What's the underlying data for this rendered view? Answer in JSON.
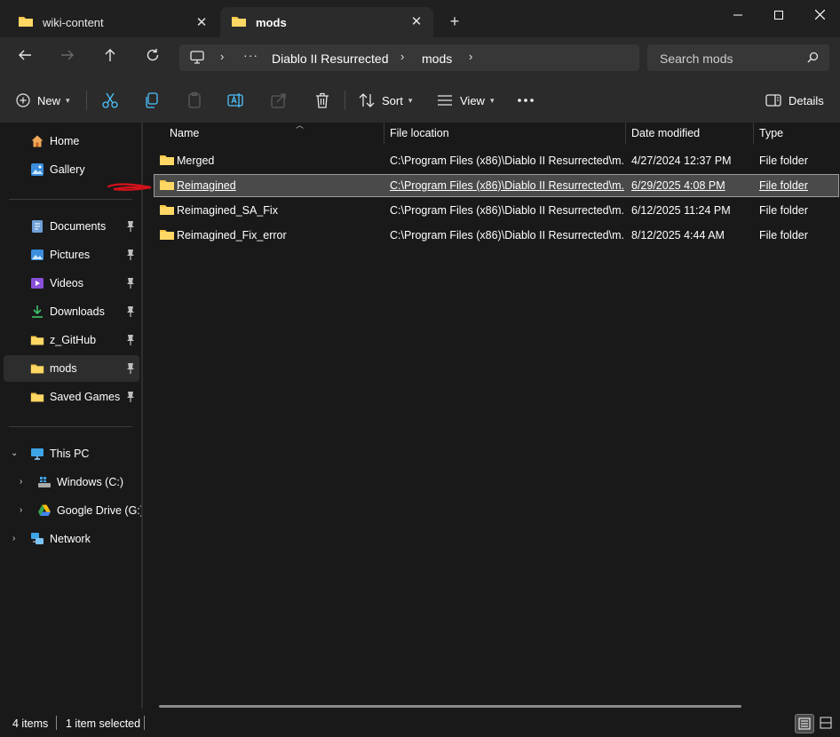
{
  "tabs": [
    {
      "label": "wiki-content",
      "active": false
    },
    {
      "label": "mods",
      "active": true
    }
  ],
  "address": {
    "crumbs": [
      "Diablo II Resurrected",
      "mods"
    ]
  },
  "search": {
    "placeholder": "Search mods"
  },
  "commandbar": {
    "new_label": "New",
    "sort_label": "Sort",
    "view_label": "View",
    "details_label": "Details"
  },
  "sidebar": {
    "top": [
      {
        "label": "Home",
        "icon": "home-icon"
      },
      {
        "label": "Gallery",
        "icon": "gallery-icon"
      }
    ],
    "pinned": [
      {
        "label": "Documents",
        "icon": "documents-icon"
      },
      {
        "label": "Pictures",
        "icon": "pictures-icon"
      },
      {
        "label": "Videos",
        "icon": "videos-icon"
      },
      {
        "label": "Downloads",
        "icon": "downloads-icon"
      },
      {
        "label": "z_GitHub",
        "icon": "folder-icon"
      },
      {
        "label": "mods",
        "icon": "folder-icon",
        "selected": true
      },
      {
        "label": "Saved Games",
        "icon": "folder-icon"
      }
    ],
    "tree": [
      {
        "label": "This PC",
        "icon": "this-pc-icon",
        "expanded": true
      },
      {
        "label": "Windows (C:)",
        "icon": "drive-icon"
      },
      {
        "label": "Google Drive (G:)",
        "icon": "google-drive-icon"
      },
      {
        "label": "Network",
        "icon": "network-icon"
      }
    ]
  },
  "columns": [
    "Name",
    "File location",
    "Date modified",
    "Type"
  ],
  "files": [
    {
      "name": "Merged",
      "location": "C:\\Program Files (x86)\\Diablo II Resurrected\\m...",
      "modified": "4/27/2024 12:37 PM",
      "type": "File folder",
      "selected": false
    },
    {
      "name": "Reimagined",
      "location": "C:\\Program Files (x86)\\Diablo II Resurrected\\m...",
      "modified": "6/29/2025 4:08 PM",
      "type": "File folder",
      "selected": true
    },
    {
      "name": "Reimagined_SA_Fix",
      "location": "C:\\Program Files (x86)\\Diablo II Resurrected\\m...",
      "modified": "6/12/2025 11:24 PM",
      "type": "File folder",
      "selected": false
    },
    {
      "name": "Reimagined_Fix_error",
      "location": "C:\\Program Files (x86)\\Diablo II Resurrected\\m...",
      "modified": "8/12/2025 4:44 AM",
      "type": "File folder",
      "selected": false
    }
  ],
  "status": {
    "item_count": "4 items",
    "selection": "1 item selected"
  },
  "colors": {
    "folder": "#f8c548",
    "selection_bg": "#4a4a4a",
    "annotation": "#d4121a"
  }
}
